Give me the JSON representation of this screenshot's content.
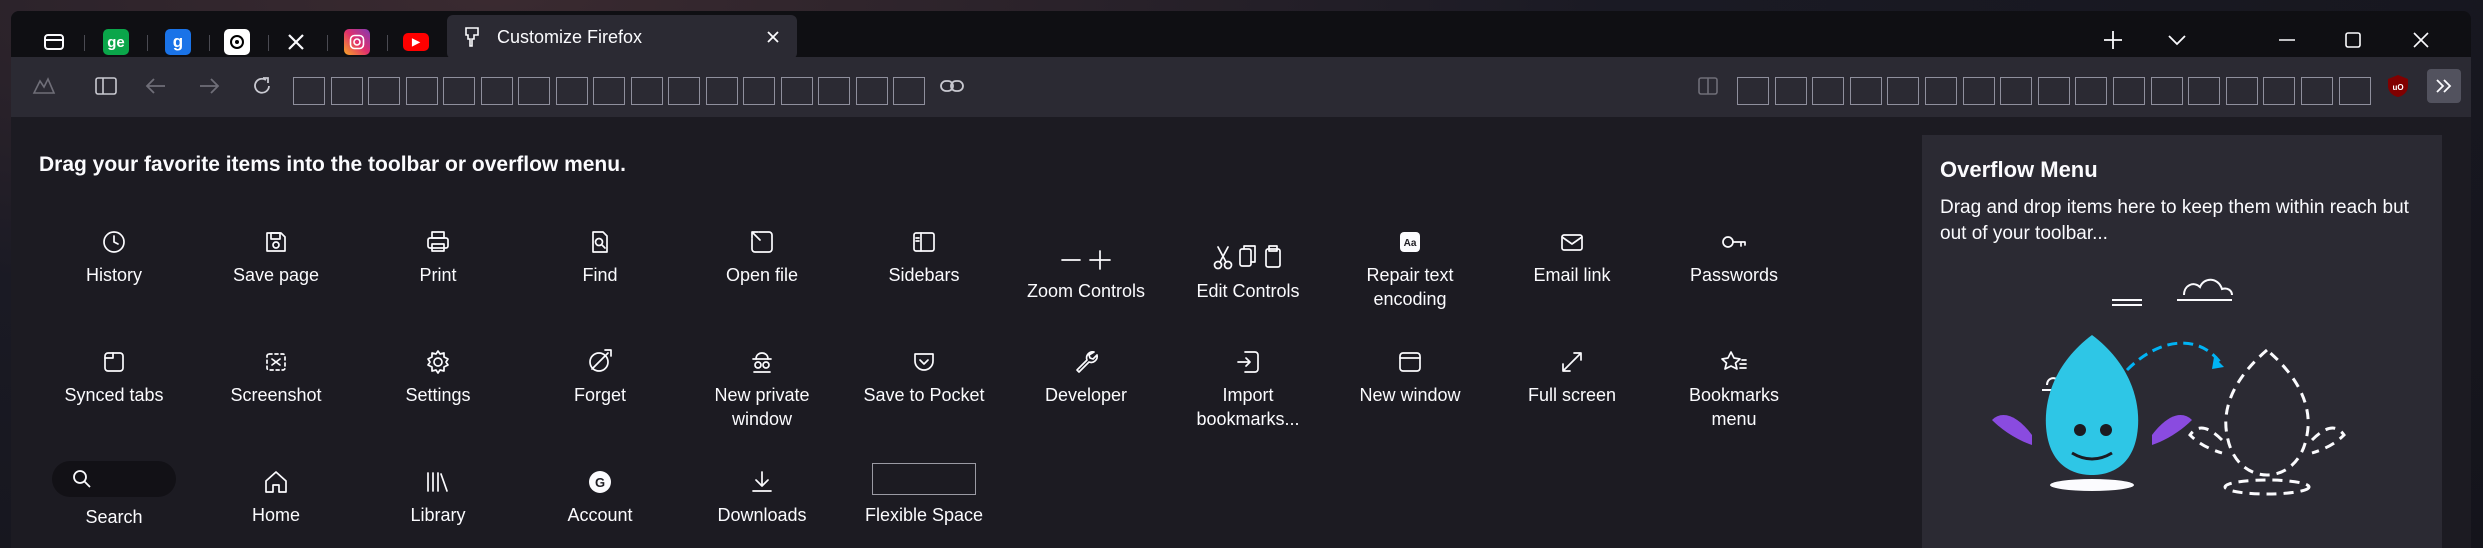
{
  "tabs": {
    "pinned": [
      {
        "name": "tab-overview",
        "letter": "",
        "color": "#3a3944"
      },
      {
        "name": "tab-ge",
        "letter": "ge",
        "color": "#10a37f"
      },
      {
        "name": "tab-g",
        "letter": "g",
        "color": "#1a73e8"
      },
      {
        "name": "tab-chatgpt",
        "letter": "",
        "color": "#ffffff"
      },
      {
        "name": "tab-x",
        "letter": "𝕏",
        "color": "#000000"
      },
      {
        "name": "tab-instagram",
        "letter": "",
        "color": "#e1306c"
      },
      {
        "name": "tab-youtube",
        "letter": "▶",
        "color": "#ff0000"
      }
    ],
    "active_title": "Customize Firefox"
  },
  "customize": {
    "heading": "Drag your favorite items into the toolbar or overflow menu.",
    "items": [
      {
        "id": "history",
        "label": "History",
        "icon": "history-icon"
      },
      {
        "id": "save-page",
        "label": "Save page",
        "icon": "save-page-icon"
      },
      {
        "id": "print",
        "label": "Print",
        "icon": "print-icon"
      },
      {
        "id": "find",
        "label": "Find",
        "icon": "find-icon"
      },
      {
        "id": "open-file",
        "label": "Open file",
        "icon": "open-file-icon"
      },
      {
        "id": "sidebars",
        "label": "Sidebars",
        "icon": "sidebars-icon"
      },
      {
        "id": "zoom-controls",
        "label": "Zoom Controls",
        "icon": "zoom-controls-icon"
      },
      {
        "id": "edit-controls",
        "label": "Edit Controls",
        "icon": "edit-controls-icon"
      },
      {
        "id": "repair-text-encoding",
        "label": "Repair text encoding",
        "icon": "repair-text-encoding-icon"
      },
      {
        "id": "email-link",
        "label": "Email link",
        "icon": "email-link-icon"
      },
      {
        "id": "passwords",
        "label": "Passwords",
        "icon": "passwords-icon"
      },
      {
        "id": "synced-tabs",
        "label": "Synced tabs",
        "icon": "synced-tabs-icon"
      },
      {
        "id": "screenshot",
        "label": "Screenshot",
        "icon": "screenshot-icon"
      },
      {
        "id": "settings",
        "label": "Settings",
        "icon": "settings-icon"
      },
      {
        "id": "forget",
        "label": "Forget",
        "icon": "forget-icon"
      },
      {
        "id": "new-private-window",
        "label": "New private window",
        "icon": "new-private-window-icon"
      },
      {
        "id": "save-to-pocket",
        "label": "Save to Pocket",
        "icon": "pocket-icon"
      },
      {
        "id": "developer",
        "label": "Developer",
        "icon": "developer-icon"
      },
      {
        "id": "import-bookmarks",
        "label": "Import bookmarks...",
        "icon": "import-bookmarks-icon"
      },
      {
        "id": "new-window",
        "label": "New window",
        "icon": "new-window-icon"
      },
      {
        "id": "full-screen",
        "label": "Full screen",
        "icon": "full-screen-icon"
      },
      {
        "id": "bookmarks-menu",
        "label": "Bookmarks menu",
        "icon": "bookmarks-menu-icon"
      },
      {
        "id": "search",
        "label": "Search",
        "icon": "search-icon"
      },
      {
        "id": "home",
        "label": "Home",
        "icon": "home-icon"
      },
      {
        "id": "library",
        "label": "Library",
        "icon": "library-icon"
      },
      {
        "id": "account",
        "label": "Account",
        "icon": "account-icon"
      },
      {
        "id": "downloads",
        "label": "Downloads",
        "icon": "downloads-icon"
      },
      {
        "id": "flexible-space",
        "label": "Flexible Space",
        "icon": "flexible-space-icon"
      }
    ]
  },
  "overflow_menu": {
    "title": "Overflow Menu",
    "description": "Drag and drop items here to keep them within reach but out of your toolbar..."
  },
  "colors": {
    "accent": "#00b3f4",
    "mascot": "#2ec6e6",
    "wing": "#8a4be0"
  }
}
